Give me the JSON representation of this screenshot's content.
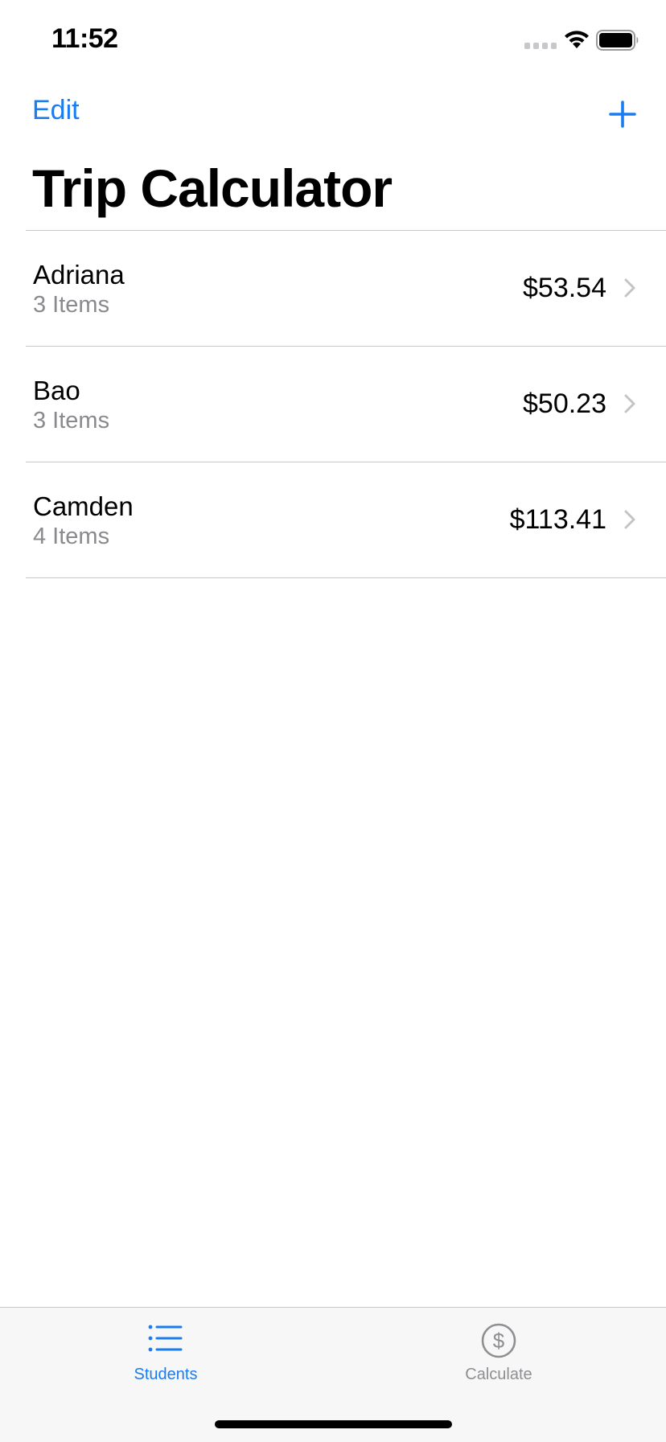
{
  "status_bar": {
    "time": "11:52"
  },
  "nav": {
    "edit_label": "Edit",
    "add_icon": "plus-icon",
    "title": "Trip Calculator"
  },
  "students": [
    {
      "name": "Adriana",
      "items": "3 Items",
      "amount": "$53.54"
    },
    {
      "name": "Bao",
      "items": "3 Items",
      "amount": "$50.23"
    },
    {
      "name": "Camden",
      "items": "4 Items",
      "amount": "$113.41"
    }
  ],
  "tab_bar": {
    "tabs": [
      {
        "label": "Students",
        "icon": "list-icon",
        "selected": true
      },
      {
        "label": "Calculate",
        "icon": "dollar-circle-icon",
        "selected": false
      }
    ]
  },
  "colors": {
    "accent": "#1a7cf2",
    "secondary_text": "#8a8a8e",
    "separator": "#c8c7cc",
    "tab_bar_bg": "#f7f7f7"
  }
}
